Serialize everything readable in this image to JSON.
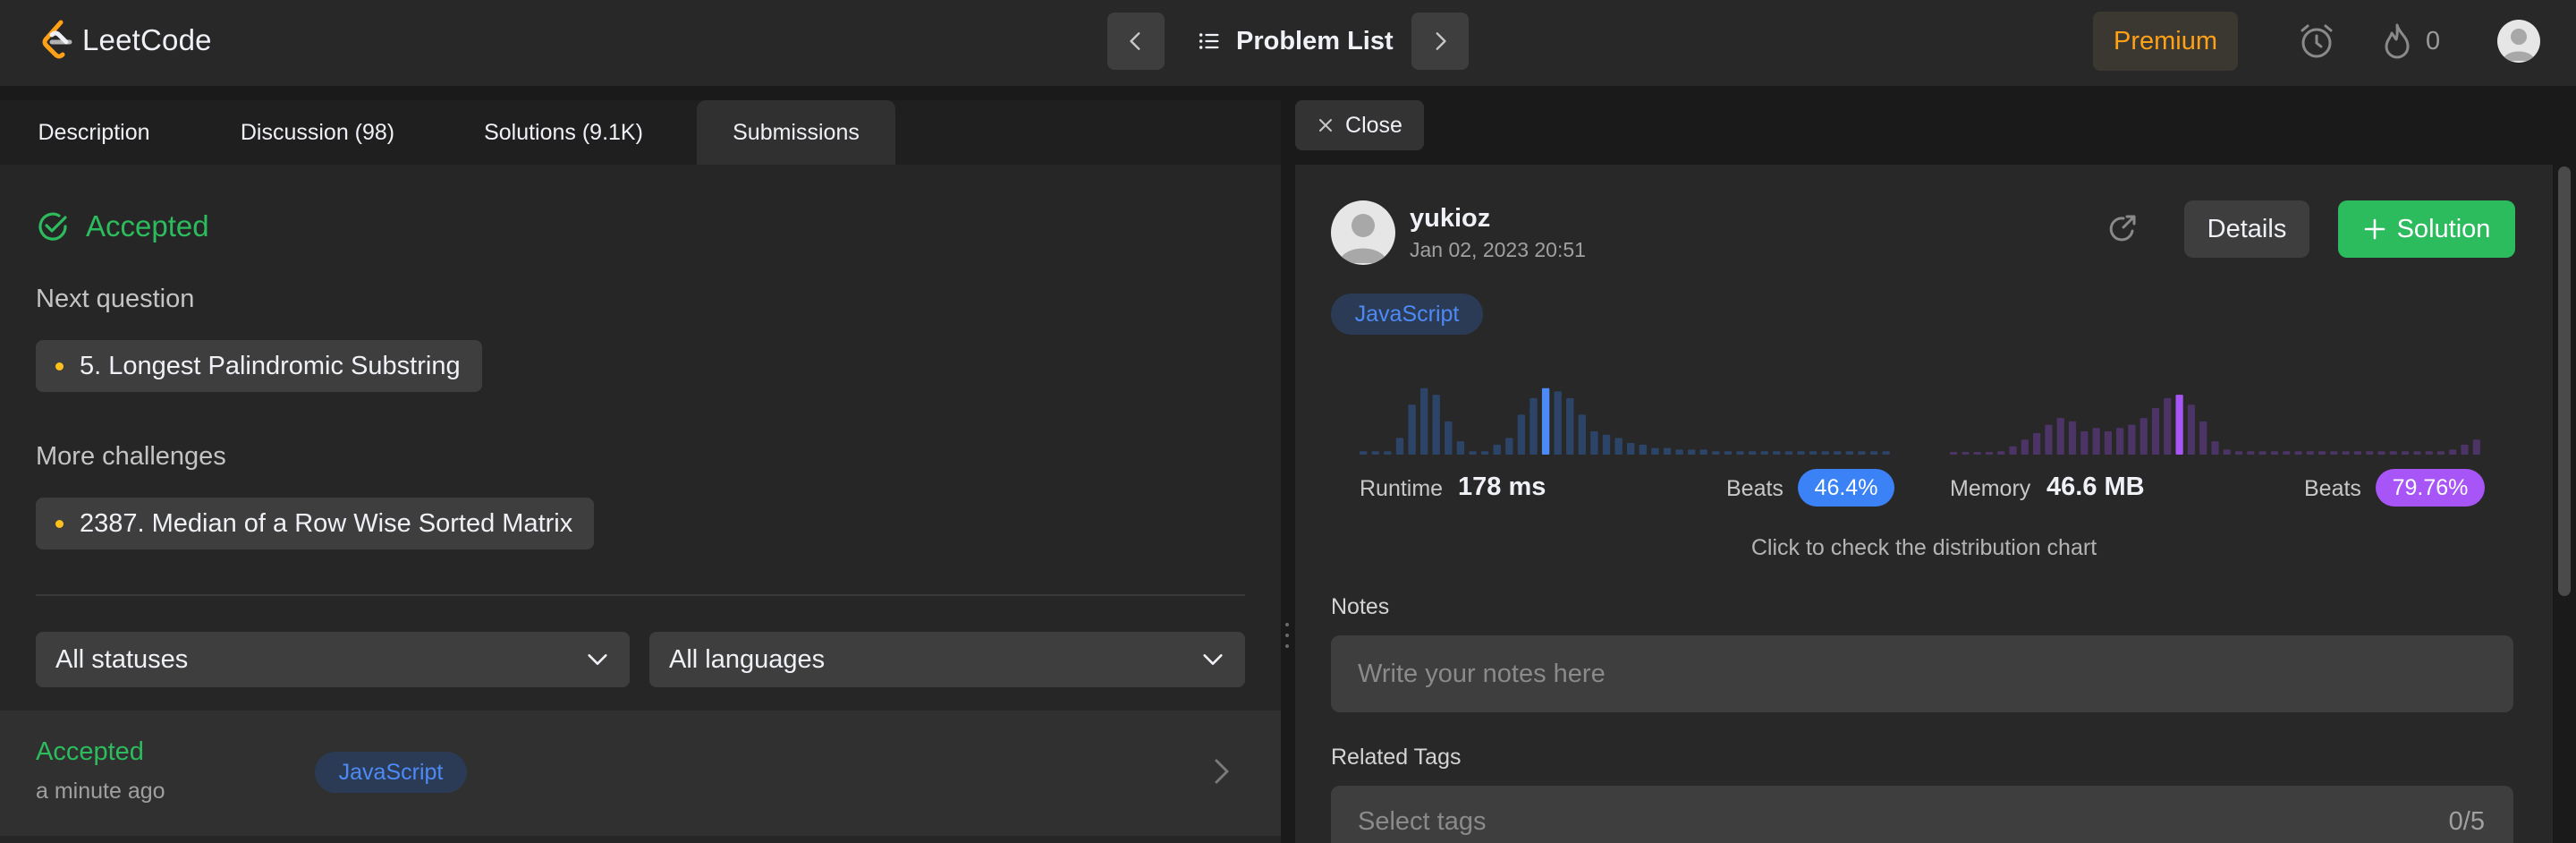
{
  "topbar": {
    "logo_text": "LeetCode",
    "problem_list_label": "Problem List",
    "premium_label": "Premium",
    "streak_count": "0",
    "accent_color": "#ffa116"
  },
  "left": {
    "tabs": [
      {
        "label": "Description"
      },
      {
        "label": "Discussion (98)"
      },
      {
        "label": "Solutions (9.1K)"
      },
      {
        "label": "Submissions"
      }
    ],
    "active_tab": "Submissions",
    "result_title": "Accepted",
    "next_question_label": "Next question",
    "next_question": "5. Longest Palindromic Substring",
    "more_challenges_label": "More challenges",
    "more_challenge": "2387. Median of a Row Wise Sorted Matrix",
    "status_filter": "All statuses",
    "language_filter": "All languages",
    "submission": {
      "status": "Accepted",
      "time": "a minute ago",
      "language": "JavaScript"
    }
  },
  "right": {
    "close_label": "Close",
    "username": "yukioz",
    "datetime": "Jan 02, 2023 20:51",
    "details_label": "Details",
    "solution_label": "Solution",
    "language": "JavaScript",
    "runtime_label": "Runtime",
    "runtime_value": "178 ms",
    "runtime_beats_label": "Beats",
    "runtime_beats": "46.4%",
    "memory_label": "Memory",
    "memory_value": "46.6 MB",
    "memory_beats_label": "Beats",
    "memory_beats": "79.76%",
    "distribution_hint": "Click to check the distribution chart",
    "notes_label": "Notes",
    "notes_placeholder": "Write your notes here",
    "tags_label": "Related Tags",
    "tags_placeholder": "Select tags",
    "tags_count": "0/5",
    "colors": {
      "success": "#2cbb5d",
      "runtime_bar": "#4c8bf5",
      "memory_bar": "#a855f7"
    }
  },
  "chart_data": [
    {
      "type": "bar",
      "name": "runtime-distribution",
      "values": [
        2,
        2,
        2,
        10,
        30,
        40,
        36,
        20,
        8,
        2,
        2,
        6,
        10,
        24,
        34,
        40,
        38,
        34,
        24,
        14,
        12,
        10,
        7,
        6,
        4,
        4,
        3,
        3,
        3,
        2,
        2,
        2,
        2,
        2,
        2,
        2,
        2,
        2,
        2,
        2,
        2,
        2,
        2,
        2
      ],
      "highlight_index": 15,
      "ylim": [
        0,
        42
      ]
    },
    {
      "type": "bar",
      "name": "memory-distribution",
      "values": [
        1,
        1,
        1,
        1,
        2,
        5,
        9,
        13,
        18,
        22,
        20,
        14,
        16,
        14,
        16,
        18,
        22,
        28,
        34,
        36,
        30,
        20,
        8,
        3,
        2,
        2,
        2,
        2,
        2,
        2,
        2,
        2,
        2,
        2,
        2,
        2,
        2,
        2,
        2,
        2,
        2,
        2,
        3,
        6,
        9
      ],
      "highlight_index": 19,
      "ylim": [
        0,
        42
      ]
    }
  ]
}
